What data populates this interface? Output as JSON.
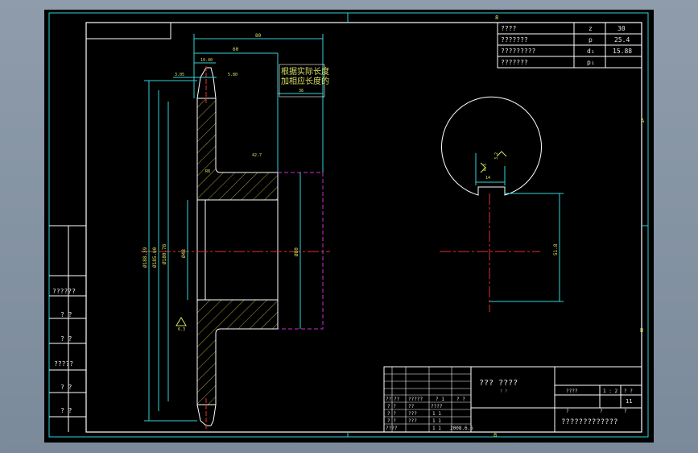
{
  "zone_labels": {
    "top": "8",
    "right_a": "A",
    "right_b": "B",
    "bottom": "8"
  },
  "param_table": {
    "rows": [
      {
        "name": "????",
        "sym": "z",
        "val": "30"
      },
      {
        "name": "???????",
        "sym": "p",
        "val": "25.4"
      },
      {
        "name": "?????????",
        "sym": "d₁",
        "val": "15.88"
      },
      {
        "name": "???????",
        "sym": "p₁",
        "val": ""
      }
    ]
  },
  "side_labels": [
    "??????",
    "? ?",
    "? ?",
    "?????",
    "? ?",
    "? ?"
  ],
  "note": {
    "line1": "根据实际长度",
    "line2": "加相应长度的"
  },
  "dims": {
    "d_top1": "80",
    "d_top2": "60",
    "d_small1": "10.40",
    "d_small2": "3.05",
    "d_small3": "5.80",
    "d_right_note": "36",
    "d_fillet": "R8",
    "d_len": "42.7",
    "d_dia1": "Ø188.39",
    "d_dia2": "Ø185.00",
    "d_dia3": "Ø180.78",
    "d_bore": "Ø48",
    "d_hub": "Ø80",
    "rough": "6.3",
    "rough2": "3.2",
    "key_w": "14",
    "key_h": "51.8",
    "key_rough": "6.3"
  },
  "title_block": {
    "main": "??? ????",
    "sub": "? ?",
    "scale_hdr": [
      "????",
      "1 : 2",
      "? ?"
    ],
    "scale_val": "11",
    "bottom_row": [
      "?",
      "?",
      "?"
    ],
    "org": "?????????????",
    "date": "2008.6.5",
    "left_rows": [
      [
        "? ?",
        "??",
        "????"
      ],
      [
        "? ?",
        "???",
        "1 1"
      ],
      [
        "? ?",
        "???",
        "1 1"
      ],
      [
        "????",
        "",
        "1 1"
      ]
    ],
    "mid_hdr": [
      "??",
      "??",
      "?????",
      "? 1",
      "? ?"
    ]
  }
}
